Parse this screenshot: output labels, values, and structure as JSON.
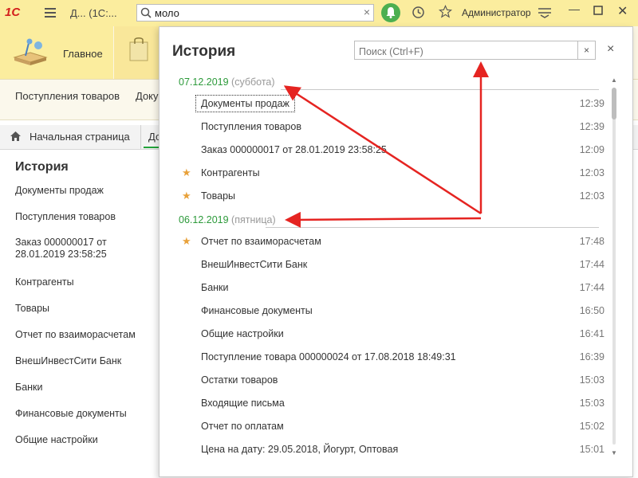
{
  "topbar": {
    "logo": "1С",
    "app_title": "Д... (1С:...",
    "search_value": "моло",
    "user": "Администратор"
  },
  "sections": {
    "home_label": "Главное"
  },
  "commands": {
    "item1": "Поступления товаров",
    "item2": "Доку"
  },
  "tabs": {
    "home": "Начальная страница",
    "doc": "До"
  },
  "left_panel": {
    "title": "История",
    "items": [
      "Документы продаж",
      "Поступления товаров",
      "Заказ 000000017 от 28.01.2019 23:58:25",
      "Контрагенты",
      "Товары",
      "Отчет по взаиморасчетам",
      "ВнешИнвестСити Банк",
      "Банки",
      "Финансовые документы",
      "Общие настройки"
    ]
  },
  "popup": {
    "title": "История",
    "search_placeholder": "Поиск (Ctrl+F)",
    "groups": [
      {
        "date": "07.12.2019",
        "weekday": "(суббота)",
        "rows": [
          {
            "name": "Документы продаж",
            "time": "12:39",
            "starred": false,
            "selected": true
          },
          {
            "name": "Поступления товаров",
            "time": "12:39",
            "starred": false,
            "selected": false
          },
          {
            "name": "Заказ 000000017 от 28.01.2019 23:58:25",
            "time": "12:09",
            "starred": false,
            "selected": false
          },
          {
            "name": "Контрагенты",
            "time": "12:03",
            "starred": true,
            "selected": false
          },
          {
            "name": "Товары",
            "time": "12:03",
            "starred": true,
            "selected": false
          }
        ]
      },
      {
        "date": "06.12.2019",
        "weekday": "(пятница)",
        "rows": [
          {
            "name": "Отчет по взаиморасчетам",
            "time": "17:48",
            "starred": true,
            "selected": false
          },
          {
            "name": "ВнешИнвестСити Банк",
            "time": "17:44",
            "starred": false,
            "selected": false
          },
          {
            "name": "Банки",
            "time": "17:44",
            "starred": false,
            "selected": false
          },
          {
            "name": "Финансовые документы",
            "time": "16:50",
            "starred": false,
            "selected": false
          },
          {
            "name": "Общие настройки",
            "time": "16:41",
            "starred": false,
            "selected": false
          },
          {
            "name": "Поступление товара 000000024 от 17.08.2018 18:49:31",
            "time": "16:39",
            "starred": false,
            "selected": false
          },
          {
            "name": "Остатки товаров",
            "time": "15:03",
            "starred": false,
            "selected": false
          },
          {
            "name": "Входящие письма",
            "time": "15:03",
            "starred": false,
            "selected": false
          },
          {
            "name": "Отчет по оплатам",
            "time": "15:02",
            "starred": false,
            "selected": false
          },
          {
            "name": "Цена на дату: 29.05.2018, Йогурт, Оптовая",
            "time": "15:01",
            "starred": false,
            "selected": false
          }
        ]
      }
    ]
  },
  "colors": {
    "accent_green": "#2c9a3a",
    "star": "#e8a13a",
    "annotation_arrow": "#e52421",
    "topbar": "#fbed9e"
  }
}
